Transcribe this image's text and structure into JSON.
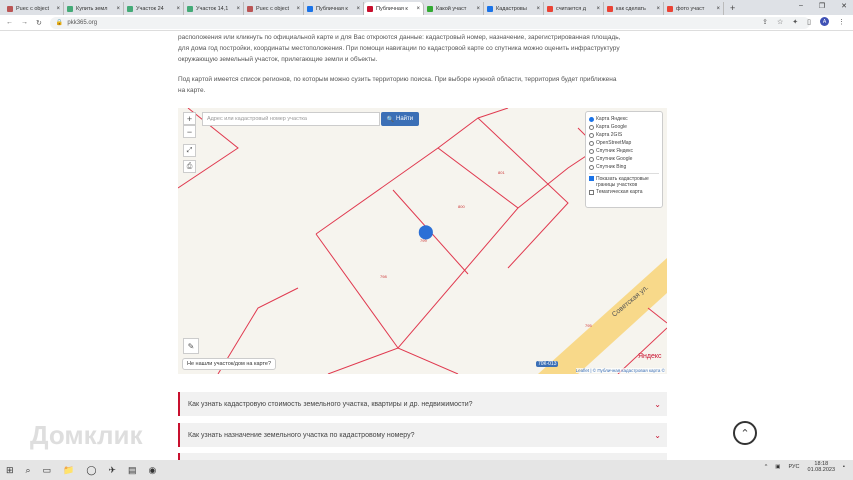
{
  "browser": {
    "tabs": [
      {
        "label": "Рuес с object",
        "color": "#b55"
      },
      {
        "label": "Купить земл",
        "color": "#4a7"
      },
      {
        "label": "Участок 24",
        "color": "#4a7"
      },
      {
        "label": "Участок 14,1",
        "color": "#4a7"
      },
      {
        "label": "Рuес с object",
        "color": "#b55"
      },
      {
        "label": "Публичная к",
        "color": "#1a73e8"
      },
      {
        "label": "Публичная к",
        "color": "#c8102e",
        "active": true
      },
      {
        "label": "Какой участ",
        "color": "#3a3"
      },
      {
        "label": "Кадастровы",
        "color": "#1a73e8"
      },
      {
        "label": "считается д",
        "color": "#ea4335"
      },
      {
        "label": "как сделать",
        "color": "#ea4335"
      },
      {
        "label": "фото участ",
        "color": "#ea4335"
      }
    ],
    "url": "pkk365.org",
    "avatar": "А"
  },
  "content": {
    "para1_line1": "расположения или кликнуть по официальной карте и для Вас откроются данные: кадастровый номер, назначение, зарегистрированная площадь,",
    "para1_line2": "для дома год постройки, координаты местоположения. При помощи навигации по кадастровой карте со спутника можно оценить инфраструктуру",
    "para1_line3": "окружающую земельный участок, прилегающие земли и объекты.",
    "para2_line1": "Под картой имеется список регионов, по которым можно сузить территорию поиска. При выборе нужной области, территория будет приближена",
    "para2_line2": "на карте."
  },
  "map": {
    "search_placeholder": "Адрес или кадастровый номер участка",
    "find_button": "Найти",
    "zoom_in": "+",
    "zoom_out": "−",
    "layers": [
      "Карта Яндекс",
      "Карта Google",
      "Карта 2GIS",
      "OpenStreetMap",
      "Спутник Яндекс",
      "Спутник Google",
      "Спутник Bing"
    ],
    "selected_layer": "Карта Яндекс",
    "show_borders": "Показать кадастровые границы участков",
    "thematic": "Тематическая карта",
    "hint": "Не нашли участок/дом на карте?",
    "parcels": [
      "801",
      "800",
      "799",
      "798",
      "795"
    ],
    "street": "Советская ул.",
    "road_badge": "70К-013",
    "yandex": "Яндекс",
    "attribution": "Leaflet | © Публичная кадастровая карта ©"
  },
  "faq": [
    "Как узнать кадастровую стоимость земельного участка, квартиры и др. недвижимости?",
    "Как узнать назначение земельного участка по кадастровому номеру?"
  ],
  "watermark": "Домклик",
  "taskbar": {
    "lang": "РУС",
    "time": "18:18",
    "date": "01.08.2023"
  }
}
